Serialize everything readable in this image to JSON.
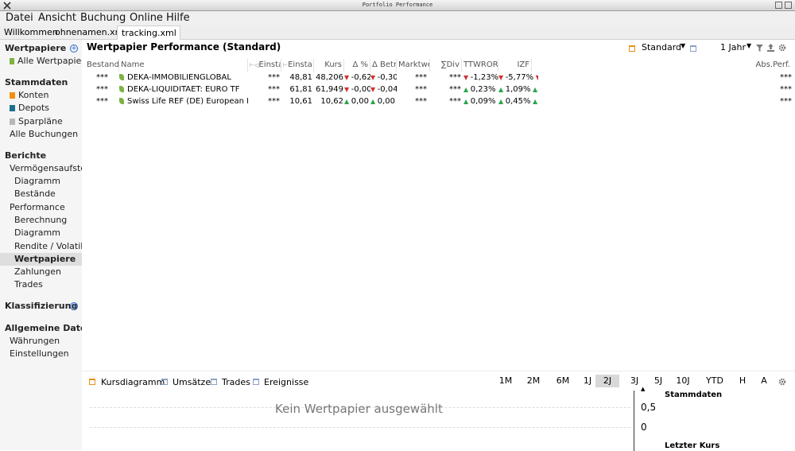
{
  "window": {
    "title": "Portfolio Performance"
  },
  "menu": [
    "Datei",
    "Ansicht",
    "Buchung",
    "Online",
    "Hilfe"
  ],
  "tabs": [
    {
      "label": "Willkommen"
    },
    {
      "label": "ohnenamen.xml"
    },
    {
      "label": "tracking.xml",
      "close": "×"
    }
  ],
  "sidebar": {
    "wertpapiere_header": "Wertpapiere",
    "alle_wertpapiere": "Alle Wertpapiere",
    "stammdaten_header": "Stammdaten",
    "konten": "Konten",
    "depots": "Depots",
    "sparplaene": "Sparpläne",
    "alle_buchungen": "Alle Buchungen",
    "berichte_header": "Berichte",
    "vermoegen": "Vermögensaufstell",
    "diagramm1": "Diagramm",
    "bestaende": "Bestände",
    "performance": "Performance",
    "berechnung": "Berechnung",
    "diagramm2": "Diagramm",
    "rendite": "Rendite / Volatilit",
    "wertpapiere": "Wertpapiere",
    "zahlungen": "Zahlungen",
    "trades": "Trades",
    "klassifizierung_header": "Klassifizierung",
    "allgemein_header": "Allgemeine Dater",
    "waehrungen": "Währungen",
    "einstellungen": "Einstellungen",
    "colors": {
      "konten": "#f29111",
      "depots": "#1e6f8e",
      "sparplaene": "#b8b8b8",
      "leaf": "#7cb342"
    }
  },
  "main": {
    "title": "Wertpapier Performance (Standard)",
    "view": "Standard",
    "period": "1 Jahr",
    "columns": [
      "Bestand",
      "Name",
      "Einsta",
      "Einsta",
      "Kurs",
      "Δ %",
      "Δ Betr",
      "Marktwe",
      "∑Div",
      "TTWROR",
      "IZF",
      "Abs.Perf."
    ],
    "rows": [
      {
        "bestand": "***",
        "name": "DEKA-IMMOBILIENGLOBAL",
        "einst1": "***",
        "einst2": "48,81",
        "kurs": "48,206",
        "dpct": "-0,62",
        "dpct_dir": "down",
        "dbetr": "-0,30",
        "dbetr_dir": "down",
        "markt": "***",
        "div": "***",
        "ttwror": "-1,23%",
        "ttwror_dir": "down",
        "izf": "-5,77%",
        "izf_dir": "down",
        "izf_trend": "down",
        "abs": "***"
      },
      {
        "bestand": "***",
        "name": "DEKA-LIQUIDITAET: EURO TF",
        "einst1": "***",
        "einst2": "61,81",
        "kurs": "61,949",
        "dpct": "-0,00",
        "dpct_dir": "down",
        "dbetr": "-0,04",
        "dbetr_dir": "down",
        "markt": "***",
        "div": "***",
        "ttwror": "0,23%",
        "ttwror_dir": "up",
        "izf": "1,09%",
        "izf_dir": "up",
        "izf_trend": "up",
        "abs": "***"
      },
      {
        "bestand": "***",
        "name": "Swiss Life REF (DE) European L",
        "einst1": "***",
        "einst2": "10,61",
        "kurs": "10,62",
        "dpct": "0,00",
        "dpct_dir": "up",
        "dbetr": "0,00",
        "dbetr_dir": "up",
        "markt": "***",
        "div": "***",
        "ttwror": "0,09%",
        "ttwror_dir": "up",
        "izf": "0,45%",
        "izf_dir": "up",
        "izf_trend": "up",
        "abs": "***"
      }
    ]
  },
  "bottom": {
    "tabs": [
      "Kursdiagramm",
      "Umsätze",
      "Trades",
      "Ereignisse"
    ],
    "ranges": [
      "1M",
      "2M",
      "6M",
      "1J",
      "2J",
      "3J",
      "5J",
      "10J",
      "YTD",
      "H",
      "A"
    ],
    "active_range": "2J",
    "empty_text": "Kein Wertpapier ausgewählt",
    "y_ticks": [
      "0,5",
      "0"
    ],
    "info_header1": "Stammdaten",
    "info_header2": "Letzter Kurs"
  }
}
